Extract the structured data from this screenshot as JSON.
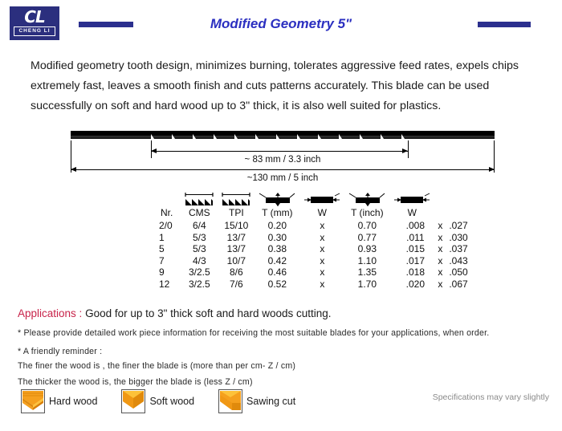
{
  "header": {
    "logo_text": "CL",
    "logo_subtext": "CHENG LI",
    "title": "Modified Geometry 5\"",
    "rule_color": "#2b2f8e",
    "logo_bg": "#2b2f7e",
    "title_color": "#2b2fc0"
  },
  "intro": {
    "paragraph": "Modified geometry tooth design, minimizes burning, tolerates aggressive feed rates, expels chips extremely fast, leaves a smooth finish and cuts patterns accurately. This blade can be used successfully on soft and hard wood up to 3\" thick, it is also well suited for plastics."
  },
  "diagram": {
    "toothed_length_label": "~ 83 mm / 3.3 inch",
    "total_length_label": "~130 mm / 5 inch",
    "blade_icon": "bandsaw-blade",
    "tooth_count": 12
  },
  "table": {
    "headers": [
      {
        "label": "Nr.",
        "icon": null
      },
      {
        "label": "CMS",
        "icon": "sawtooth-icon"
      },
      {
        "label": "TPI",
        "icon": "sawtooth-icon"
      },
      {
        "label": "T  (mm)",
        "icon": "thickness-icon"
      },
      {
        "label": "W",
        "icon": "width-icon"
      },
      {
        "label": "T  (inch)",
        "icon": "thickness-icon"
      },
      {
        "label": "W",
        "icon": "width-icon"
      }
    ],
    "separator": "x",
    "rows": [
      {
        "nr": "2/0",
        "cms": "6/4",
        "tpi": "15/10",
        "t_mm": "0.20",
        "w_mm": "0.70",
        "t_in": ".008",
        "w_in": ".027"
      },
      {
        "nr": "1",
        "cms": "5/3",
        "tpi": "13/7",
        "t_mm": "0.30",
        "w_mm": "0.77",
        "t_in": ".011",
        "w_in": ".030"
      },
      {
        "nr": "5",
        "cms": "5/3",
        "tpi": "13/7",
        "t_mm": "0.38",
        "w_mm": "0.93",
        "t_in": ".015",
        "w_in": ".037"
      },
      {
        "nr": "7",
        "cms": "4/3",
        "tpi": "10/7",
        "t_mm": "0.42",
        "w_mm": "1.10",
        "t_in": ".017",
        "w_in": ".043"
      },
      {
        "nr": "9",
        "cms": "3/2.5",
        "tpi": "8/6",
        "t_mm": "0.46",
        "w_mm": "1.35",
        "t_in": ".018",
        "w_in": ".050"
      },
      {
        "nr": "12",
        "cms": "3/2.5",
        "tpi": "7/6",
        "t_mm": "0.52",
        "w_mm": "1.70",
        "t_in": ".020",
        "w_in": ".067"
      }
    ]
  },
  "applications": {
    "keyword": "Applications :",
    "value": "Good for up to 3\" thick soft and hard woods cutting.",
    "keyword_color": "#c8234a"
  },
  "notes": {
    "note1": "* Please provide detailed work piece information for receiving the most suitable blades for your applications, when order.",
    "note2": "* A friendly reminder :",
    "note3": "The finer the wood is , the finer the blade is (more than per cm- Z / cm)",
    "note4": "The thicker the wood is, the bigger the blade is (less Z / cm)"
  },
  "legend": {
    "items": [
      {
        "label": "Hard wood",
        "icon": "hard-wood-icon"
      },
      {
        "label": "Soft wood",
        "icon": "soft-wood-icon"
      },
      {
        "label": "Sawing cut",
        "icon": "sawing-cut-icon"
      }
    ],
    "wood_color": "#f5a01e",
    "wood_color_light": "#fdc23a",
    "wood_color_dark": "#e08a0c"
  },
  "footnote": "Specifications may vary slightly"
}
